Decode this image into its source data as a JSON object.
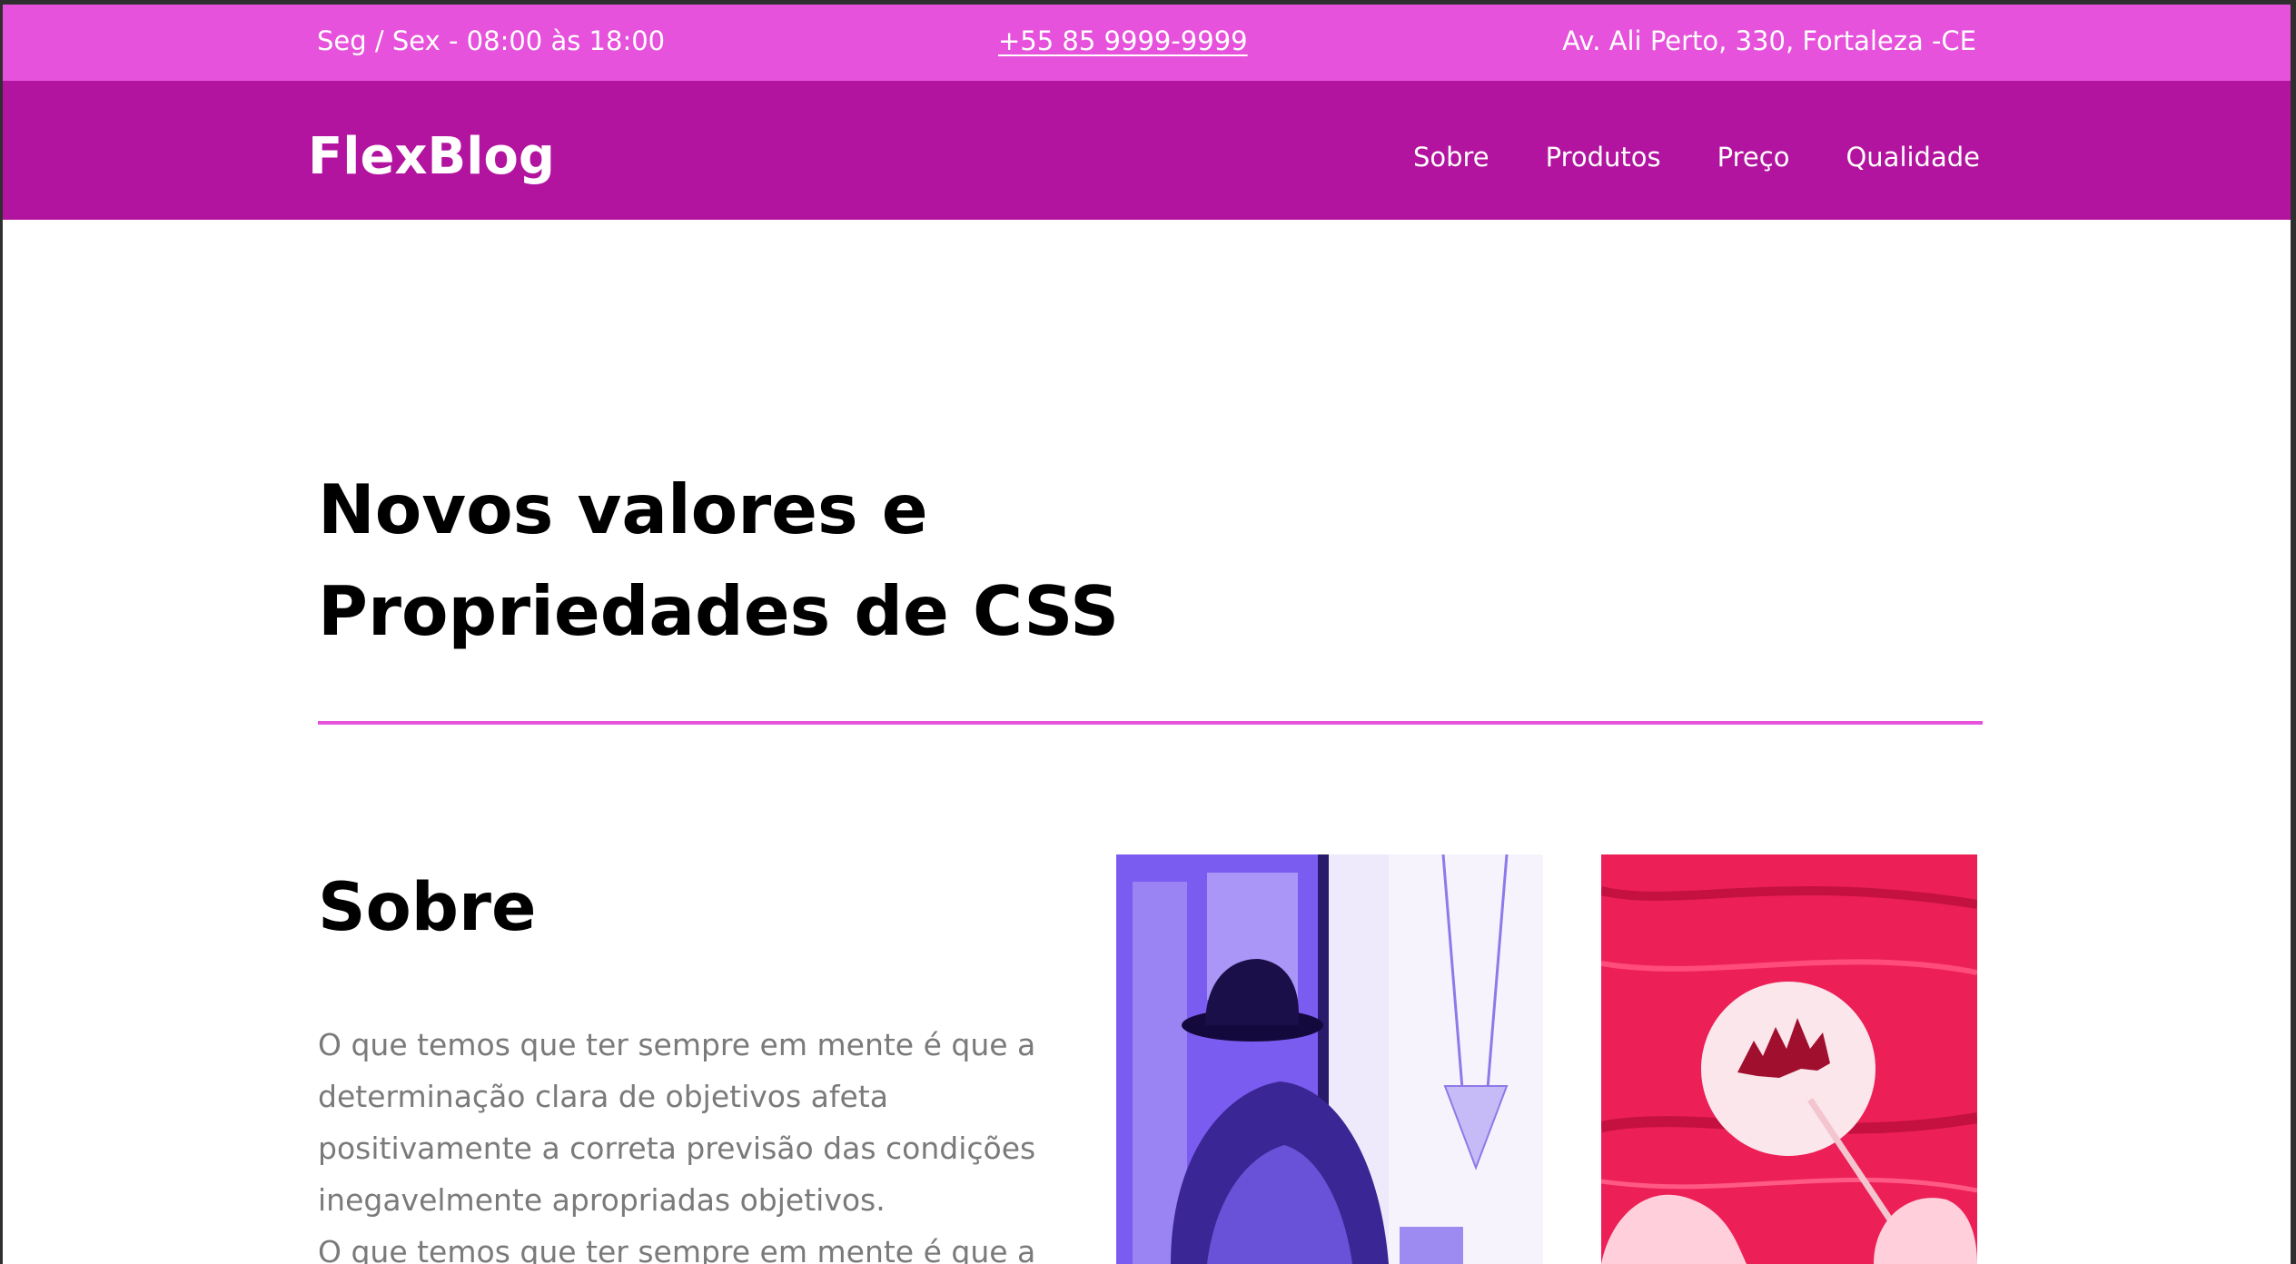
{
  "topbar": {
    "hours": "Seg / Sex - 08:00 às 18:00",
    "phone": "+55 85 9999-9999",
    "address": "Av. Ali Perto, 330, Fortaleza -CE"
  },
  "header": {
    "logo": "FlexBlog",
    "nav": [
      {
        "label": "Sobre"
      },
      {
        "label": "Produtos"
      },
      {
        "label": "Preço"
      },
      {
        "label": "Qualidade"
      }
    ]
  },
  "hero": {
    "title_line1": "Novos valores e",
    "title_line2": "Propriedades de CSS"
  },
  "about": {
    "title": "Sobre",
    "paragraph1": "O que temos que ter sempre em mente é que a determinação clara de objetivos afeta positivamente a correta previsão das condições inegavelmente apropriadas objetivos.",
    "paragraph2": "O que temos que ter sempre em mente é que a"
  },
  "colors": {
    "topbar": "#e652db",
    "header": "#b2139f",
    "divider": "#e652db",
    "body_text": "#7a7a7a"
  },
  "images": [
    {
      "name": "woman-with-hat-photo",
      "tint": "#7b5cf0"
    },
    {
      "name": "hands-drawing-tree-photo",
      "tint": "#ff2a64"
    }
  ]
}
